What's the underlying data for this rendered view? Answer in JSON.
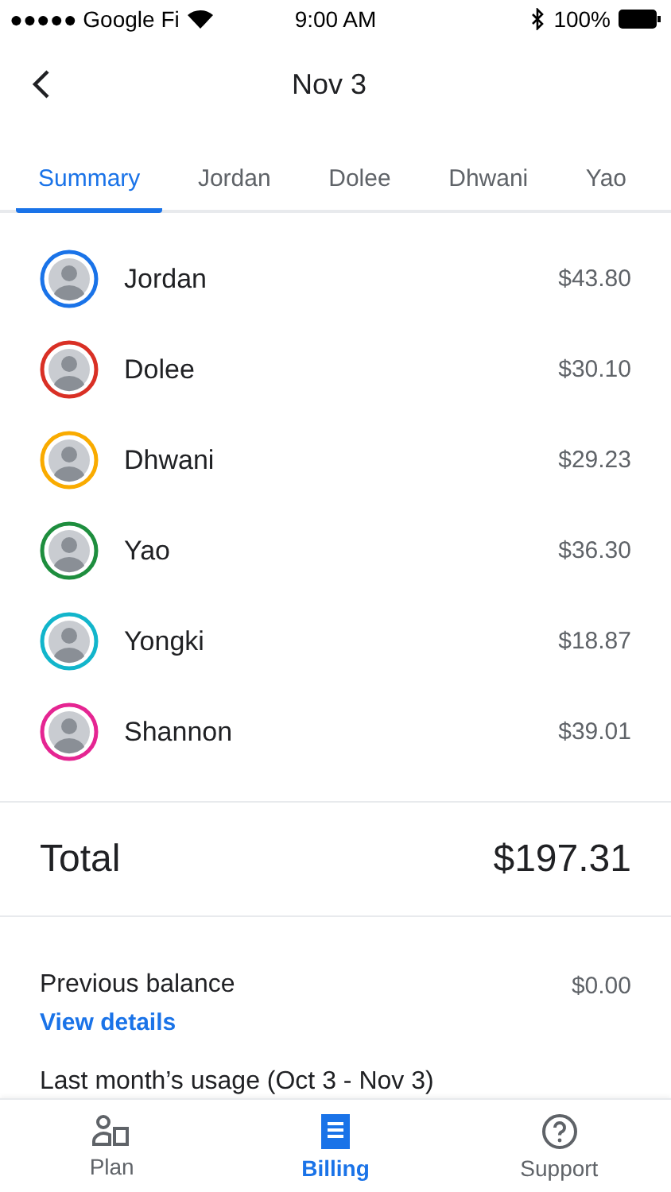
{
  "status_bar": {
    "carrier": "●●●●● Google Fi",
    "time": "9:00 AM",
    "battery": "100%"
  },
  "header": {
    "title": "Nov 3"
  },
  "tabs": [
    {
      "label": "Summary",
      "selected": true
    },
    {
      "label": "Jordan",
      "selected": false
    },
    {
      "label": "Dolee",
      "selected": false
    },
    {
      "label": "Dhwani",
      "selected": false
    },
    {
      "label": "Yao",
      "selected": false
    }
  ],
  "members": [
    {
      "name": "Jordan",
      "amount": "$43.80",
      "color": "#1a73e8"
    },
    {
      "name": "Dolee",
      "amount": "$30.10",
      "color": "#d93025"
    },
    {
      "name": "Dhwani",
      "amount": "$29.23",
      "color": "#f9ab00"
    },
    {
      "name": "Yao",
      "amount": "$36.30",
      "color": "#1e8e3e"
    },
    {
      "name": "Yongki",
      "amount": "$18.87",
      "color": "#12b5cb"
    },
    {
      "name": "Shannon",
      "amount": "$39.01",
      "color": "#e52592"
    }
  ],
  "total": {
    "label": "Total",
    "amount": "$197.31"
  },
  "previous_balance": {
    "label": "Previous balance",
    "amount": "$0.00",
    "link": "View details"
  },
  "usage_heading": "Last month’s usage (Oct 3 - Nov 3)",
  "bottom_nav": [
    {
      "label": "Plan",
      "kind": "plan",
      "selected": false
    },
    {
      "label": "Billing",
      "kind": "billing",
      "selected": true
    },
    {
      "label": "Support",
      "kind": "support",
      "selected": false
    }
  ]
}
